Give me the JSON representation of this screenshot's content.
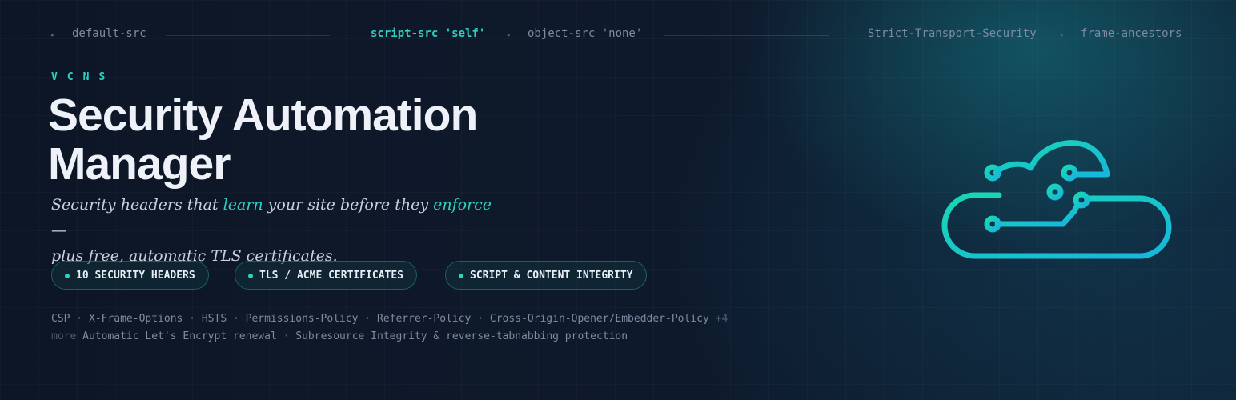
{
  "topbar": {
    "items": [
      "default-src",
      "script-src 'self'",
      "object-src 'none'",
      "Strict-Transport-Security",
      "frame-ancestors"
    ],
    "separator": "•"
  },
  "brand": "VCNS",
  "title_line1": "Security Automation",
  "title_line2": "Manager",
  "tagline": {
    "part1": "Security headers that ",
    "learn": "learn",
    "part2": " your site before they ",
    "enforce": "enforce",
    "part3": " —",
    "line2": "plus free, automatic TLS certificates."
  },
  "pills": [
    "10 SECURITY HEADERS",
    "TLS / ACME CERTIFICATES",
    "SCRIPT & CONTENT INTEGRITY"
  ],
  "features": {
    "part1": "CSP · X-Frame-Options · HSTS · Permissions-Policy · Referrer-Policy · Cross-Origin-Opener/Embedder-Policy",
    "more": "+4 more",
    "part2": "Automatic Let's Encrypt renewal",
    "sep": "·",
    "part3": "Subresource Integrity & reverse-tabnabbing protection"
  },
  "colors": {
    "accent": "#2fd0c0",
    "background": "#0d1728",
    "title": "#eef1f7"
  },
  "icons": [
    "cloud-circuit-icon"
  ]
}
